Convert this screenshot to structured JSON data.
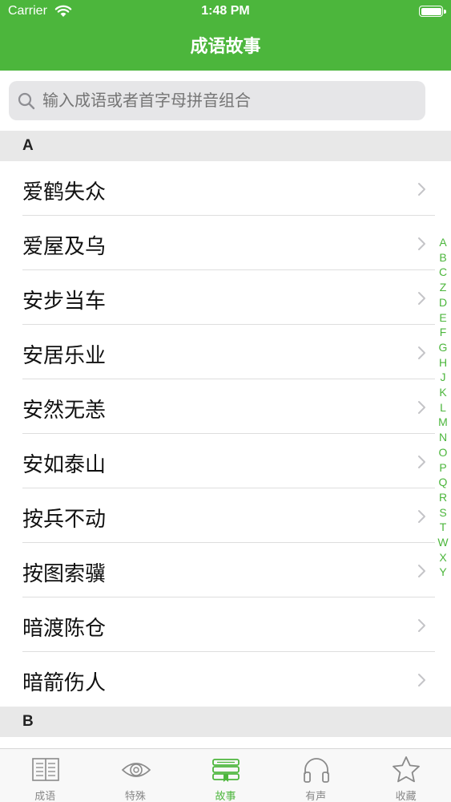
{
  "status_bar": {
    "carrier": "Carrier",
    "time": "1:48 PM"
  },
  "nav": {
    "title": "成语故事"
  },
  "search": {
    "placeholder": "输入成语或者首字母拼音组合"
  },
  "sections": [
    {
      "letter": "A",
      "items": [
        "爱鹤失众",
        "爱屋及乌",
        "安步当车",
        "安居乐业",
        "安然无恙",
        "安如泰山",
        "按兵不动",
        "按图索骥",
        "暗渡陈仓",
        "暗箭伤人"
      ]
    },
    {
      "letter": "B",
      "items": []
    }
  ],
  "index_letters": [
    "A",
    "B",
    "C",
    "Z",
    "D",
    "E",
    "F",
    "G",
    "H",
    "J",
    "K",
    "L",
    "M",
    "N",
    "O",
    "P",
    "Q",
    "R",
    "S",
    "T",
    "W",
    "X",
    "Y"
  ],
  "tabs": [
    {
      "label": "成语",
      "icon": "book-icon",
      "active": false
    },
    {
      "label": "特殊",
      "icon": "eye-icon",
      "active": false
    },
    {
      "label": "故事",
      "icon": "stacked-books-icon",
      "active": true
    },
    {
      "label": "有声",
      "icon": "headphones-icon",
      "active": false
    },
    {
      "label": "收藏",
      "icon": "star-icon",
      "active": false
    }
  ],
  "colors": {
    "accent": "#4cb63c",
    "inactive": "#888888",
    "section_bg": "#e8e8e8"
  }
}
